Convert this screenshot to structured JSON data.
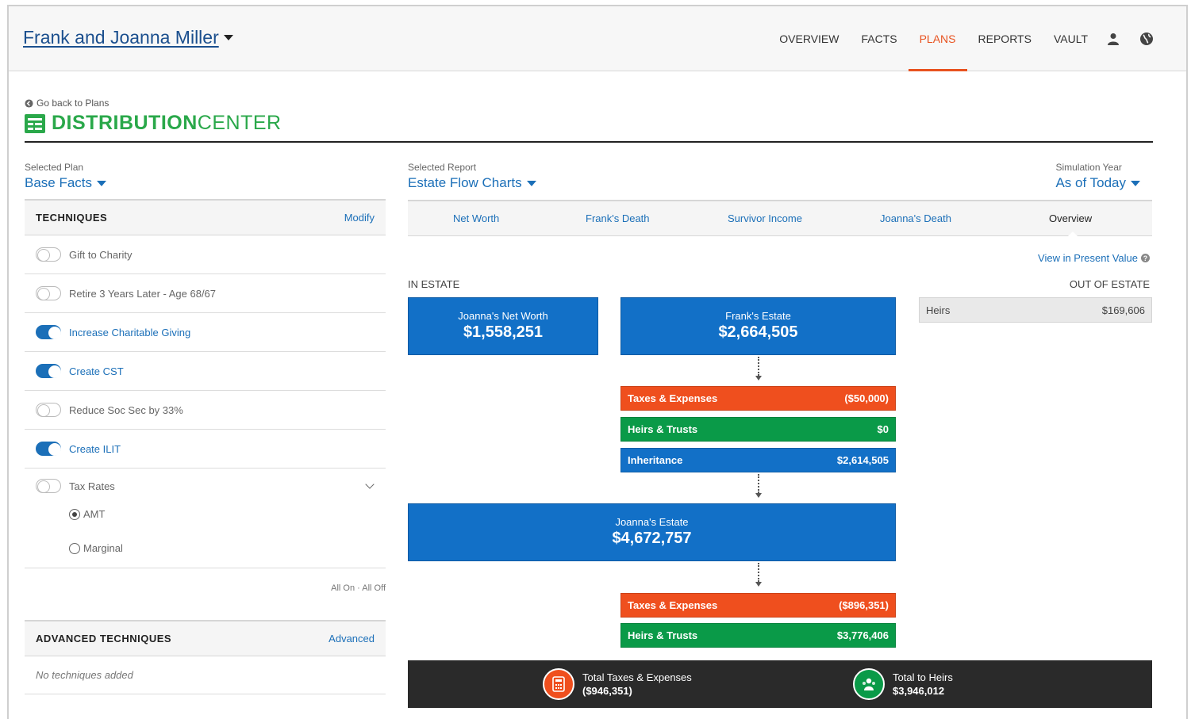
{
  "header": {
    "client_name": "Frank and Joanna Miller",
    "nav": [
      "OVERVIEW",
      "FACTS",
      "PLANS",
      "REPORTS",
      "VAULT"
    ],
    "active_nav": "PLANS",
    "icons": [
      "user-icon",
      "globe-icon"
    ]
  },
  "page": {
    "back_link": "Go back to Plans",
    "title_bold": "DISTRIBUTION",
    "title_normal": "CENTER"
  },
  "selectors": {
    "plan_label": "Selected Plan",
    "plan_value": "Base Facts",
    "report_label": "Selected Report",
    "report_value": "Estate Flow Charts",
    "year_label": "Simulation Year",
    "year_value": "As of Today"
  },
  "techniques": {
    "heading": "TECHNIQUES",
    "modify": "Modify",
    "items": [
      {
        "label": "Gift to Charity",
        "on": false
      },
      {
        "label": "Retire 3 Years Later - Age 68/67",
        "on": false
      },
      {
        "label": "Increase Charitable Giving",
        "on": true
      },
      {
        "label": "Create CST",
        "on": true
      },
      {
        "label": "Reduce Soc Sec by 33%",
        "on": false
      },
      {
        "label": "Create ILIT",
        "on": true
      }
    ],
    "tax_rates": {
      "label": "Tax Rates",
      "on": false,
      "options": [
        "AMT",
        "Marginal"
      ],
      "selected": "AMT"
    },
    "all_on_off": "All On · All Off"
  },
  "advanced": {
    "heading": "ADVANCED TECHNIQUES",
    "link": "Advanced",
    "empty": "No techniques added"
  },
  "report_tabs": {
    "items": [
      "Net Worth",
      "Frank's Death",
      "Survivor Income",
      "Joanna's Death",
      "Overview"
    ],
    "active": "Overview"
  },
  "flow": {
    "present_value_link": "View in Present Value",
    "in_estate_label": "IN ESTATE",
    "out_estate_label": "OUT OF ESTATE",
    "joanna_net_worth": {
      "label": "Joanna's Net Worth",
      "value": "$1,558,251"
    },
    "frank_estate": {
      "label": "Frank's Estate",
      "value": "$2,664,505"
    },
    "out_heirs": {
      "label": "Heirs",
      "value": "$169,606"
    },
    "frank_taxes": {
      "label": "Taxes & Expenses",
      "value": "($50,000)"
    },
    "frank_heirs": {
      "label": "Heirs & Trusts",
      "value": "$0"
    },
    "frank_inheritance": {
      "label": "Inheritance",
      "value": "$2,614,505"
    },
    "joanna_estate": {
      "label": "Joanna's Estate",
      "value": "$4,672,757"
    },
    "joanna_taxes": {
      "label": "Taxes & Expenses",
      "value": "($896,351)"
    },
    "joanna_heirs": {
      "label": "Heirs & Trusts",
      "value": "$3,776,406"
    },
    "total_taxes": {
      "label": "Total Taxes & Expenses",
      "value": "($946,351)"
    },
    "total_heirs": {
      "label": "Total to Heirs",
      "value": "$3,946,012"
    }
  },
  "colors": {
    "accent_orange": "#ef4f1e",
    "green": "#0a9a48",
    "blue": "#1270c7",
    "link_blue": "#1b6fb8",
    "title_green": "#2aa84a"
  }
}
